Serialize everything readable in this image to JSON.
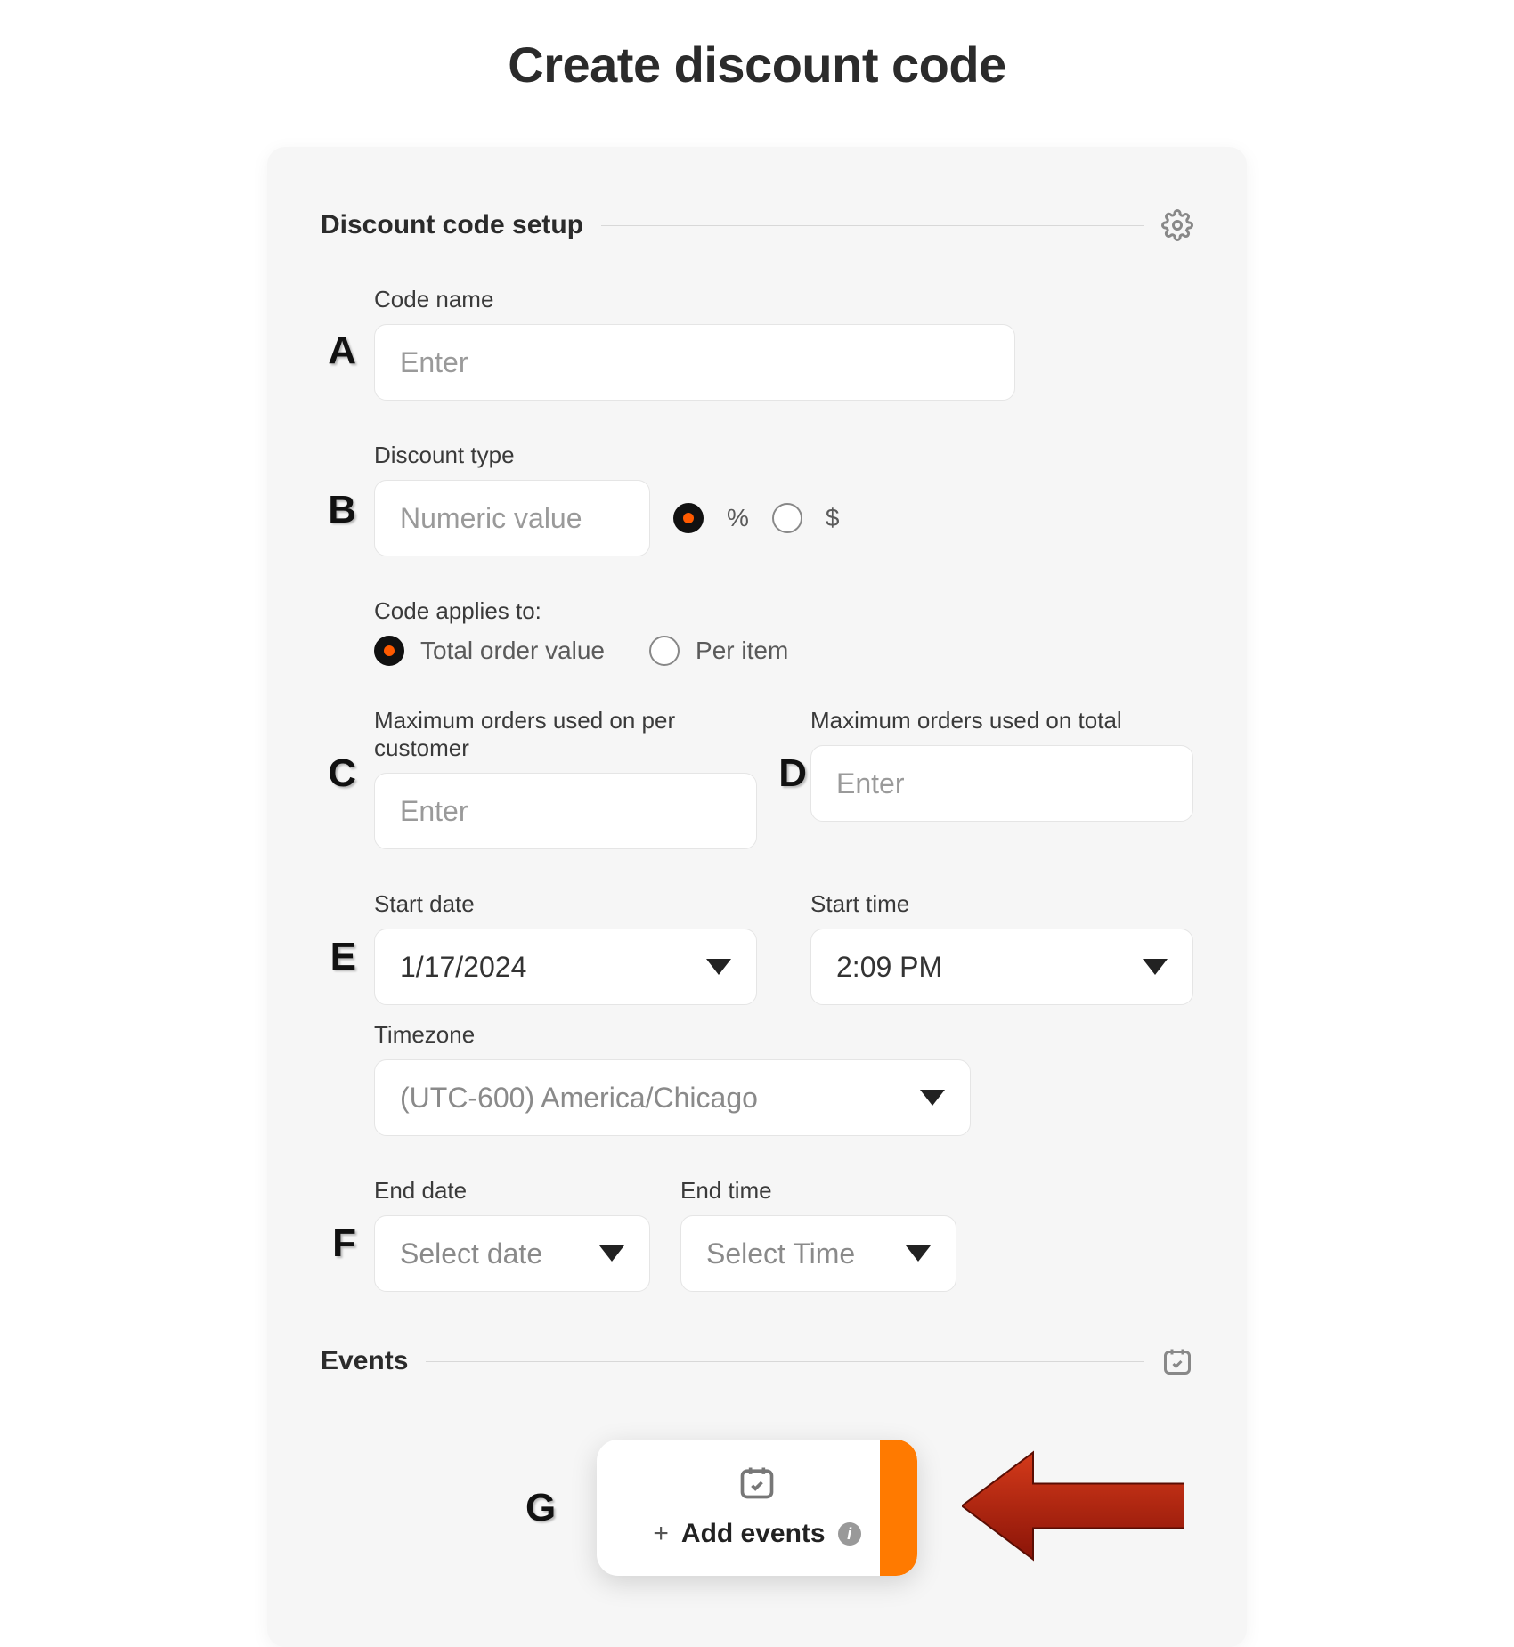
{
  "page": {
    "title": "Create discount code"
  },
  "markers": {
    "a": "A",
    "b": "B",
    "c": "C",
    "d": "D",
    "e": "E",
    "f": "F",
    "g": "G"
  },
  "setup": {
    "section_title": "Discount code setup",
    "code_name": {
      "label": "Code name",
      "placeholder": "Enter",
      "value": ""
    },
    "discount_type": {
      "label": "Discount type",
      "placeholder": "Numeric value",
      "value": "",
      "options": {
        "percent": {
          "label": "%",
          "selected": true
        },
        "dollar": {
          "label": "$",
          "selected": false
        }
      }
    },
    "applies_to": {
      "label": "Code applies to:",
      "options": {
        "total": {
          "label": "Total order value",
          "selected": true
        },
        "per_item": {
          "label": "Per item",
          "selected": false
        }
      }
    },
    "max_per_customer": {
      "label": "Maximum orders used on per customer",
      "placeholder": "Enter",
      "value": ""
    },
    "max_total": {
      "label": "Maximum orders used on total",
      "placeholder": "Enter",
      "value": ""
    },
    "start_date": {
      "label": "Start date",
      "value": "1/17/2024"
    },
    "start_time": {
      "label": "Start time",
      "value": "2:09 PM"
    },
    "timezone": {
      "label": "Timezone",
      "value": "(UTC-600) America/Chicago"
    },
    "end_date": {
      "label": "End date",
      "placeholder": "Select date",
      "value": ""
    },
    "end_time": {
      "label": "End time",
      "placeholder": "Select Time",
      "value": ""
    }
  },
  "events": {
    "section_title": "Events",
    "add_label": "Add events"
  }
}
